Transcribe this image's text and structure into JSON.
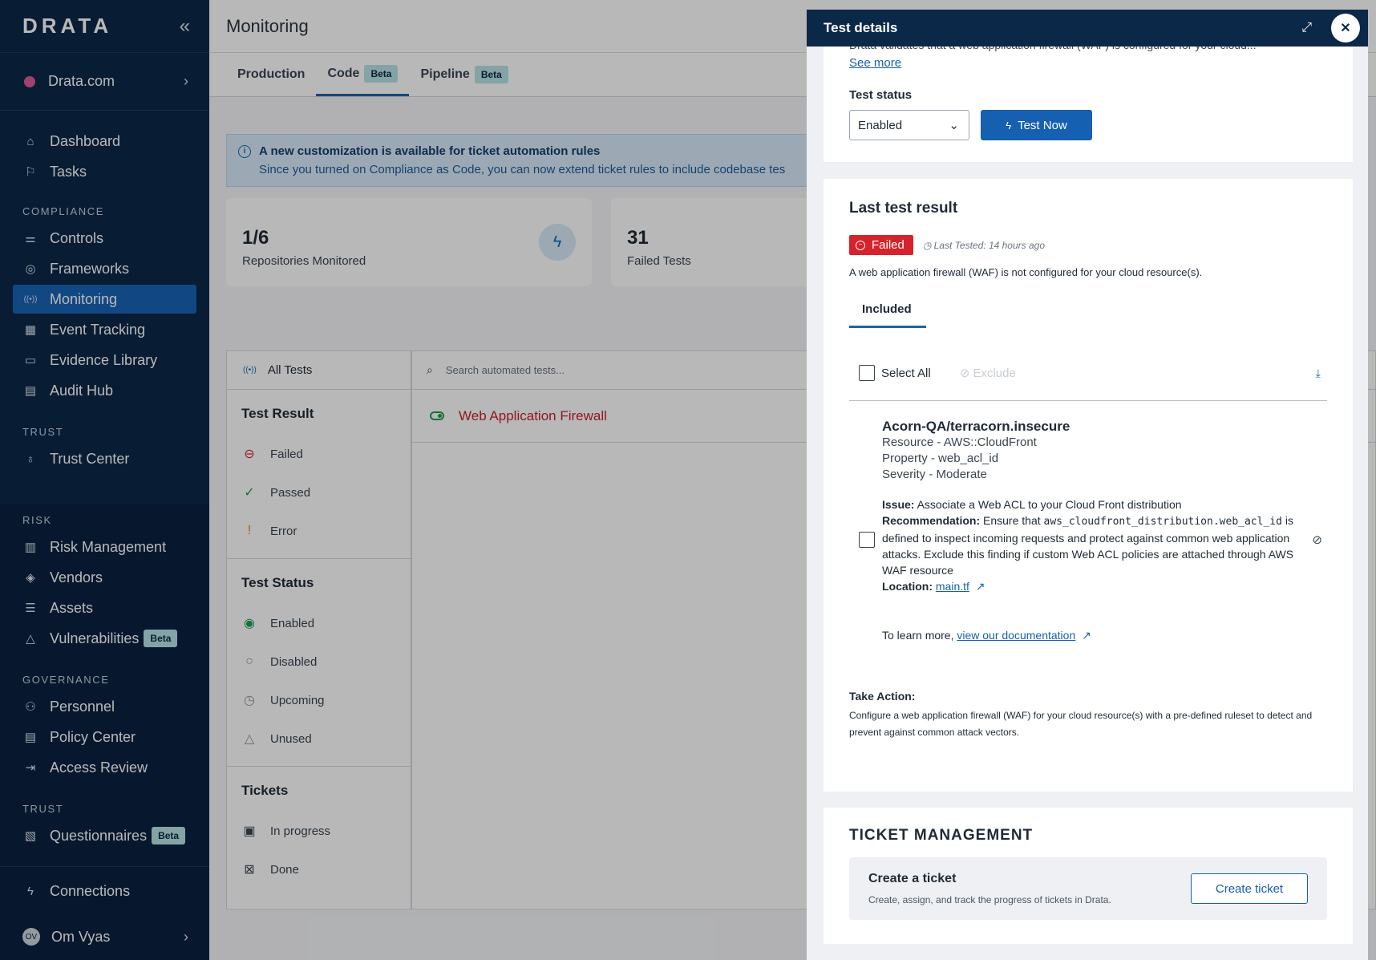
{
  "sidebar": {
    "logo": "DRATA",
    "collapse_icon": "«",
    "org": {
      "name": "Drata.com"
    },
    "nav_top": [
      {
        "label": "Dashboard",
        "icon": "home-icon",
        "glyph": "⌂"
      },
      {
        "label": "Tasks",
        "icon": "flag-icon",
        "glyph": "⚐"
      }
    ],
    "compliance_label": "COMPLIANCE",
    "compliance": [
      {
        "label": "Controls",
        "icon": "sliders-icon",
        "glyph": "⚌"
      },
      {
        "label": "Frameworks",
        "icon": "compass-icon",
        "glyph": "◎"
      },
      {
        "label": "Monitoring",
        "icon": "broadcast-icon",
        "glyph": "((•))"
      },
      {
        "label": "Event Tracking",
        "icon": "calendar-icon",
        "glyph": "▦"
      },
      {
        "label": "Evidence Library",
        "icon": "document-icon",
        "glyph": "▭"
      },
      {
        "label": "Audit Hub",
        "icon": "audit-icon",
        "glyph": "▤"
      }
    ],
    "trust_label": "TRUST",
    "trust": [
      {
        "label": "Trust Center",
        "icon": "ribbon-icon",
        "glyph": "♁"
      }
    ],
    "risk_label": "RISK",
    "risk": [
      {
        "label": "Risk Management",
        "icon": "table-icon",
        "glyph": "▥"
      },
      {
        "label": "Vendors",
        "icon": "layers-icon",
        "glyph": "◈"
      },
      {
        "label": "Assets",
        "icon": "list-icon",
        "glyph": "☰"
      },
      {
        "label": "Vulnerabilities",
        "icon": "warning-icon",
        "glyph": "△",
        "badge": "Beta"
      }
    ],
    "governance_label": "GOVERNANCE",
    "governance": [
      {
        "label": "Personnel",
        "icon": "people-icon",
        "glyph": "⚇"
      },
      {
        "label": "Policy Center",
        "icon": "policy-icon",
        "glyph": "▤"
      },
      {
        "label": "Access Review",
        "icon": "sign-in-icon",
        "glyph": "⇥"
      }
    ],
    "trust2_label": "TRUST",
    "trust2": [
      {
        "label": "Questionnaires",
        "icon": "questionnaire-icon",
        "glyph": "▧",
        "badge": "Beta"
      }
    ],
    "connections": {
      "label": "Connections",
      "icon": "bolt-icon",
      "glyph": "ϟ"
    },
    "user": {
      "initials": "OV",
      "name": "Om Vyas"
    }
  },
  "main": {
    "title": "Monitoring",
    "tabs": [
      {
        "label": "Production"
      },
      {
        "label": "Code",
        "badge": "Beta",
        "active": true
      },
      {
        "label": "Pipeline",
        "badge": "Beta"
      }
    ],
    "banner": {
      "title": "A new customization is available for ticket automation rules",
      "text": "Since you turned on Compliance as Code, you can now extend ticket rules to include codebase tes"
    },
    "stats": [
      {
        "value": "1/6",
        "label": "Repositories Monitored"
      },
      {
        "value": "31",
        "label": "Failed Tests"
      }
    ],
    "filters": {
      "all_tests": "All Tests",
      "test_result_title": "Test Result",
      "test_result": [
        {
          "label": "Failed",
          "icon": "failed-icon",
          "glyph": "⊖",
          "color": "#d7222b"
        },
        {
          "label": "Passed",
          "icon": "passed-icon",
          "glyph": "✓",
          "color": "#1e9e4f"
        },
        {
          "label": "Error",
          "icon": "error-icon",
          "glyph": "!",
          "color": "#e08a00"
        }
      ],
      "test_status_title": "Test Status",
      "test_status": [
        {
          "label": "Enabled",
          "icon": "toggle-on-icon",
          "glyph": "◉",
          "color": "#1e9e4f"
        },
        {
          "label": "Disabled",
          "icon": "toggle-off-icon",
          "glyph": "○",
          "color": "#8d96a1"
        },
        {
          "label": "Upcoming",
          "icon": "clock-icon",
          "glyph": "◷",
          "color": "#8d96a1"
        },
        {
          "label": "Unused",
          "icon": "triangle-icon",
          "glyph": "△",
          "color": "#8d96a1"
        }
      ],
      "tickets_title": "Tickets",
      "tickets": [
        {
          "label": "In progress",
          "icon": "clipboard-progress-icon",
          "glyph": "▣",
          "color": "#394452"
        },
        {
          "label": "Done",
          "icon": "clipboard-done-icon",
          "glyph": "⊠",
          "color": "#394452"
        }
      ]
    },
    "search_placeholder": "Search automated tests...",
    "result": {
      "name": "Web Application Firewall"
    }
  },
  "drawer": {
    "title": "Test details",
    "clipped_text": "Drata validates that a web application firewall (WAF) is configured for your cloud...",
    "see_more": "See more",
    "test_status_label": "Test status",
    "test_status_value": "Enabled",
    "test_now": "Test Now",
    "last_result_title": "Last test result",
    "status_badge": "Failed",
    "last_tested": "Last Tested: 14 hours ago",
    "result_desc": "A web application firewall (WAF) is not configured for your cloud resource(s).",
    "tab_included": "Included",
    "select_all": "Select All",
    "exclude": "Exclude",
    "finding": {
      "title": "Acorn-QA/terracorn.insecure",
      "resource": "Resource - AWS::CloudFront",
      "property": "Property - web_acl_id",
      "severity": "Severity - Moderate",
      "issue_label": "Issue:",
      "issue": "Associate a Web ACL to your Cloud Front distribution",
      "rec_label": "Recommendation:",
      "rec_pre": "Ensure that",
      "rec_code": "aws_cloudfront_distribution.web_acl_id",
      "rec_post": "is defined to inspect incoming requests and protect against common web application attacks. Exclude this finding if custom Web ACL policies are attached through AWS WAF resource",
      "location_label": "Location:",
      "location": "main.tf"
    },
    "learn_pre": "To learn more,",
    "learn_link": "view our documentation",
    "take_action_title": "Take Action:",
    "take_action_text": "Configure a web application firewall (WAF) for your cloud resource(s) with a pre-defined ruleset to detect and prevent against common attack vectors.",
    "ticket_mgmt_title": "TICKET MANAGEMENT",
    "ticket_title": "Create a ticket",
    "ticket_text": "Create, assign, and track the progress of tickets in Drata.",
    "create_ticket": "Create ticket"
  }
}
